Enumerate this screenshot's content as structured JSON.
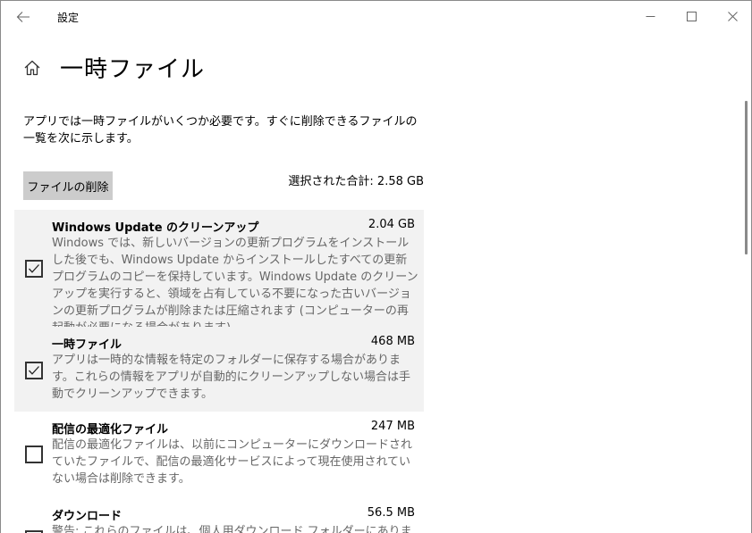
{
  "window": {
    "title": "設定",
    "icons": {
      "back": "arrow-left-icon",
      "minimize": "minimize-icon",
      "maximize": "maximize-icon",
      "close": "close-icon"
    }
  },
  "header": {
    "title": "一時ファイル",
    "home_icon": "home-icon"
  },
  "description": "アプリでは一時ファイルがいくつか必要です。すぐに削除できるファイルの一覧を次に示します。",
  "actions": {
    "delete_label": "ファイルの削除",
    "total_label": "選択された合計: 2.58 GB"
  },
  "items": [
    {
      "name": "Windows Update のクリーンアップ",
      "size": "2.04 GB",
      "checked": true,
      "description": "Windows では、新しいバージョンの更新プログラムをインストールした後でも、Windows Update からインストールしたすべての更新プログラムのコピーを保持しています。Windows Update のクリーンアップを実行すると、領域を占有している不要になった古いバージョンの更新プログラムが削除または圧縮されます (コンピューターの再起動が必要になる場合があります)。"
    },
    {
      "name": "一時ファイル",
      "size": "468 MB",
      "checked": true,
      "description": "アプリは一時的な情報を特定のフォルダーに保存する場合があります。これらの情報をアプリが自動的にクリーンアップしない場合は手動でクリーンアップできます。"
    },
    {
      "name": "配信の最適化ファイル",
      "size": "247 MB",
      "checked": false,
      "description": "配信の最適化ファイルは、以前にコンピューターにダウンロードされていたファイルで、配信の最適化サービスによって現在使用されていない場合は削除できます。"
    },
    {
      "name": "ダウンロード",
      "size": "56.5 MB",
      "checked": false,
      "description": "警告: これらのファイルは、個人用ダウンロード フォルダーにあります。すべてを"
    }
  ],
  "colors": {
    "selected_row": "#f2f2f2",
    "button_bg": "#cccccc",
    "secondary_text": "#666666"
  }
}
